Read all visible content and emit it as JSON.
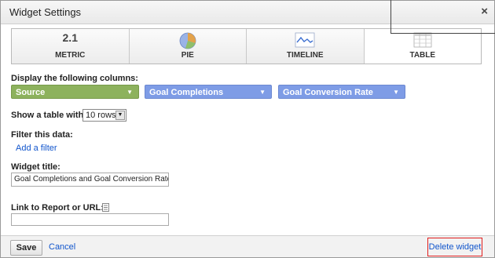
{
  "dialog": {
    "title": "Widget Settings",
    "close_glyph": "×"
  },
  "tabs": [
    {
      "label": "METRIC",
      "icon": "metric-icon",
      "icon_text": "2.1"
    },
    {
      "label": "PIE",
      "icon": "pie-chart-icon"
    },
    {
      "label": "TIMELINE",
      "icon": "timeline-chart-icon"
    },
    {
      "label": "TABLE",
      "icon": "table-icon",
      "active": true
    }
  ],
  "columns": {
    "label": "Display the following columns:",
    "dropdowns": [
      {
        "value": "Source",
        "color": "#8db25d"
      },
      {
        "value": "Goal Completions",
        "color": "#7e9ce6"
      },
      {
        "value": "Goal Conversion Rate",
        "color": "#7e9ce6"
      }
    ]
  },
  "table_size": {
    "label": "Show a table with",
    "value": "10 rows"
  },
  "filter": {
    "label": "Filter this data:",
    "add_link": "Add a filter"
  },
  "widget_title": {
    "label": "Widget title:",
    "value": "Goal Completions and Goal Conversion Rate by"
  },
  "link": {
    "label": "Link to Report or URL:",
    "value": ""
  },
  "footer": {
    "save": "Save",
    "cancel": "Cancel",
    "delete": "Delete widget"
  }
}
